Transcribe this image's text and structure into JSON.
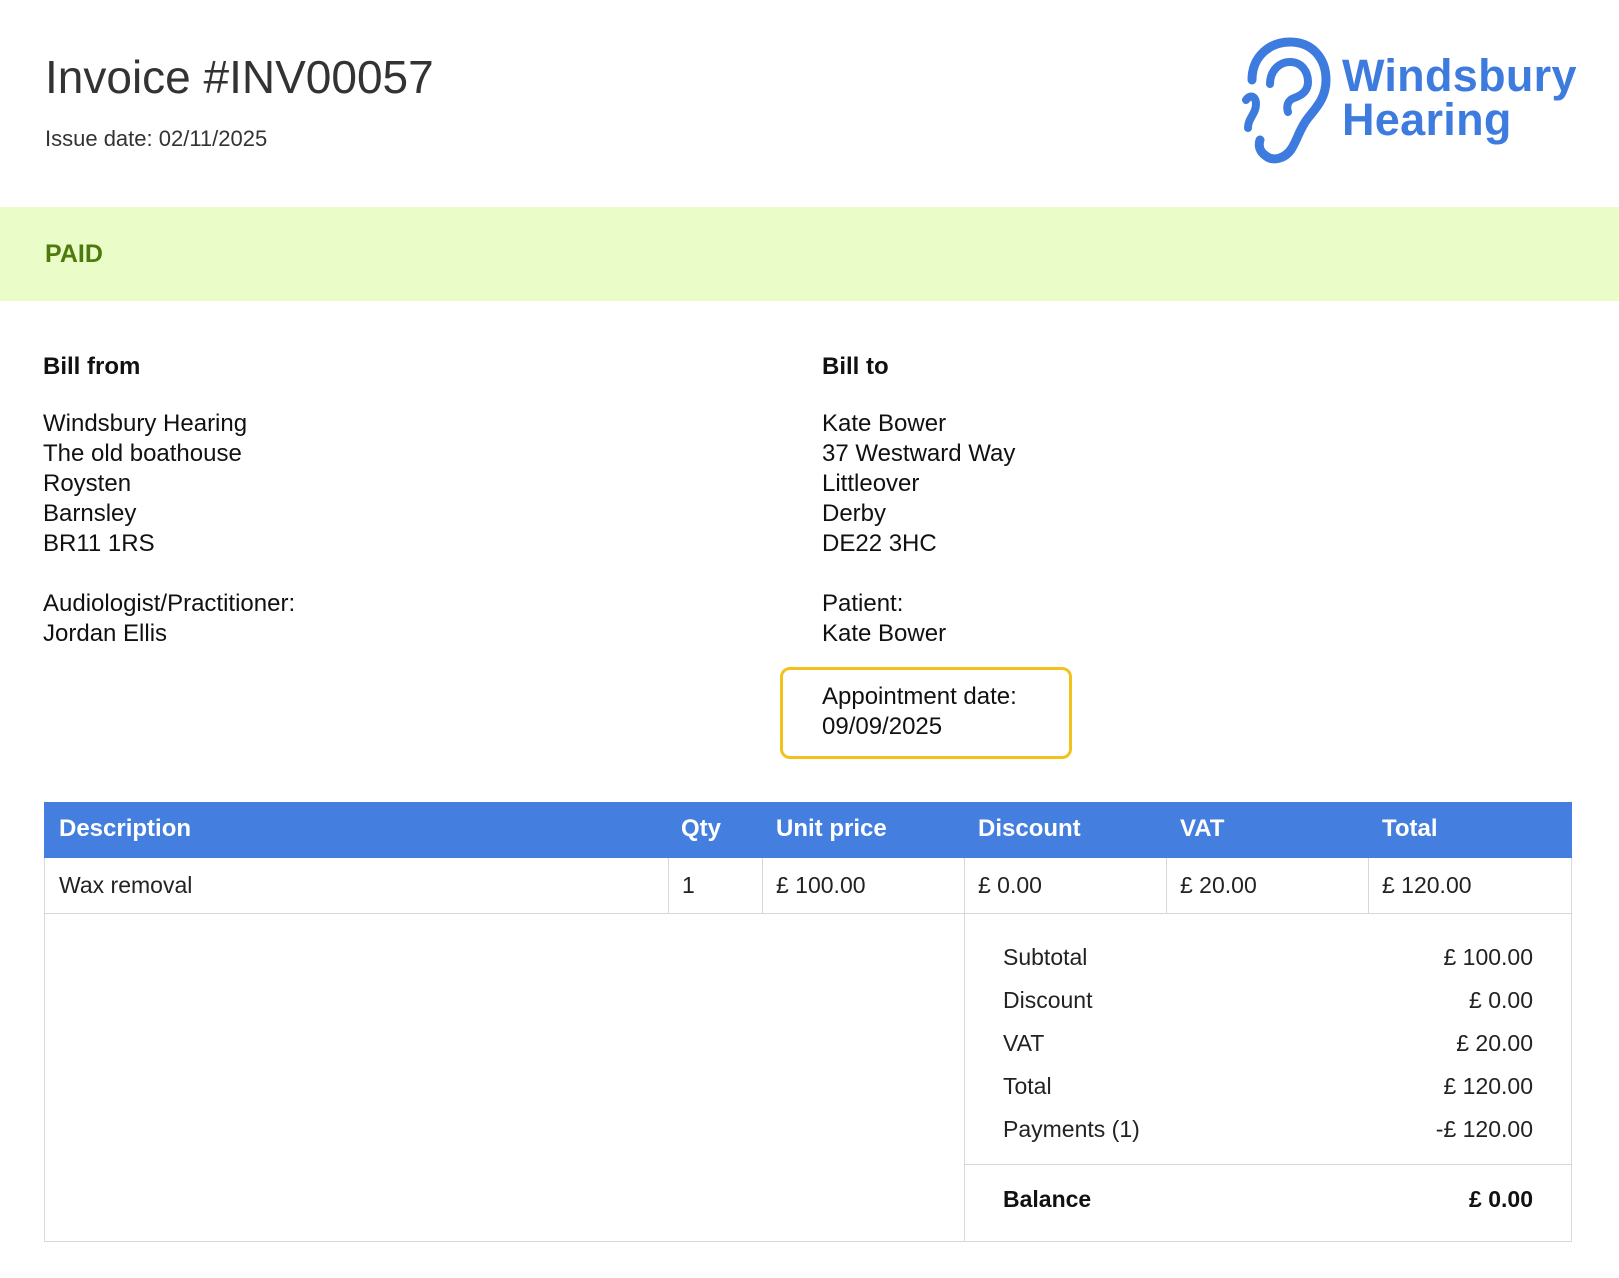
{
  "invoice": {
    "title": "Invoice #INV00057",
    "issue_date": "Issue date: 02/11/2025"
  },
  "logo": {
    "line1": "Windsbury",
    "line2": "Hearing",
    "icon": "ear-icon",
    "color": "#3e7bde"
  },
  "status": {
    "label": "PAID",
    "band_color": "#eafcc8",
    "text_color": "#4d7a0c"
  },
  "bill_from": {
    "heading": "Bill from",
    "address": [
      "Windsbury Hearing",
      "The old boathouse",
      "Roysten",
      "Barnsley",
      "BR11 1RS"
    ],
    "practitioner_label": "Audiologist/Practitioner:",
    "practitioner_name": "Jordan Ellis"
  },
  "bill_to": {
    "heading": "Bill to",
    "address": [
      "Kate Bower",
      "37 Westward Way",
      "Littleover",
      "Derby",
      "DE22 3HC"
    ],
    "patient_label": "Patient:",
    "patient_name": "Kate Bower",
    "appointment_label": "Appointment date:",
    "appointment_date": "09/09/2025",
    "highlight_color": "#f2c21b"
  },
  "table": {
    "headers": [
      "Description",
      "Qty",
      "Unit price",
      "Discount",
      "VAT",
      "Total"
    ],
    "rows": [
      [
        "Wax removal",
        "1",
        "£ 100.00",
        "£ 0.00",
        "£ 20.00",
        "£ 120.00"
      ]
    ],
    "header_color": "#447fdf"
  },
  "summary": {
    "subtotal_label": "Subtotal",
    "subtotal_value": "£ 100.00",
    "discount_label": "Discount",
    "discount_value": "£ 0.00",
    "vat_label": "VAT",
    "vat_value": "£ 20.00",
    "total_label": "Total",
    "total_value": "£ 120.00",
    "payments_label": "Payments (1)",
    "payments_value": "-£ 120.00",
    "balance_label": "Balance",
    "balance_value": "£ 0.00"
  }
}
